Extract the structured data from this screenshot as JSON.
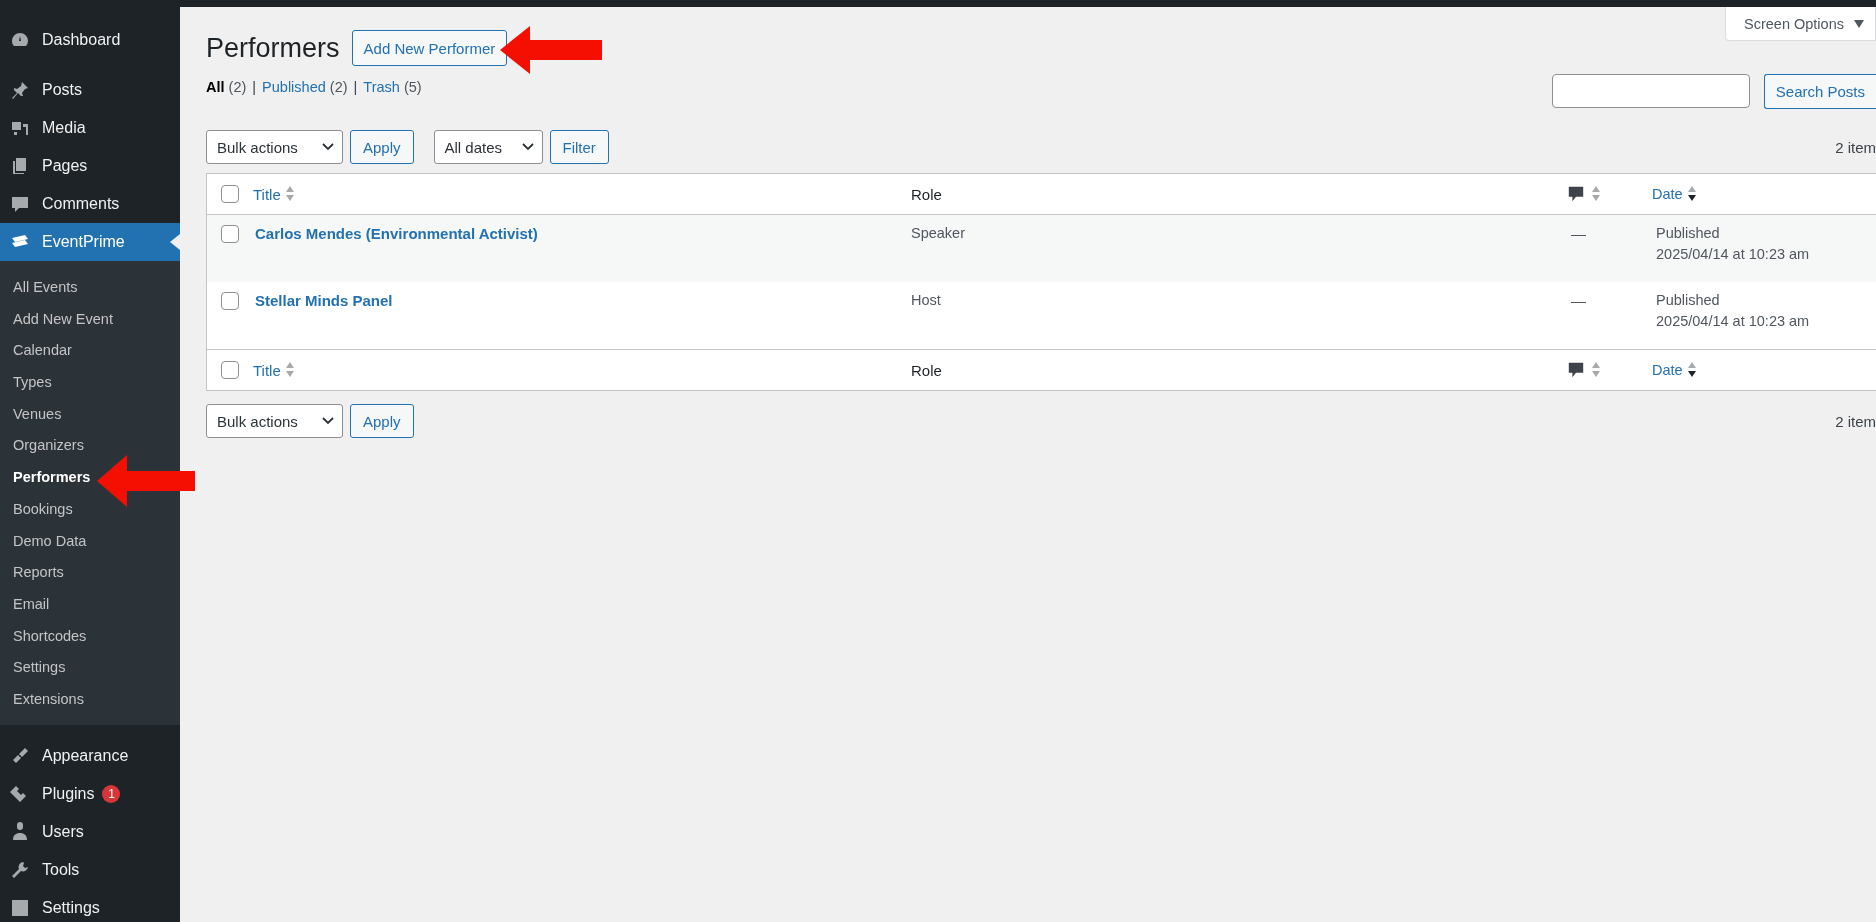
{
  "sidebar": {
    "menu": [
      {
        "label": "Dashboard",
        "selected": false
      },
      {
        "label": "Posts",
        "selected": false
      },
      {
        "label": "Media",
        "selected": false
      },
      {
        "label": "Pages",
        "selected": false
      },
      {
        "label": "Comments",
        "selected": false
      },
      {
        "label": "EventPrime",
        "selected": true,
        "children": [
          {
            "label": "All Events",
            "selected": false
          },
          {
            "label": "Add New Event",
            "selected": false
          },
          {
            "label": "Calendar",
            "selected": false
          },
          {
            "label": "Types",
            "selected": false
          },
          {
            "label": "Venues",
            "selected": false
          },
          {
            "label": "Organizers",
            "selected": false
          },
          {
            "label": "Performers",
            "selected": true
          },
          {
            "label": "Bookings",
            "selected": false
          },
          {
            "label": "Demo Data",
            "selected": false
          },
          {
            "label": "Reports",
            "selected": false
          },
          {
            "label": "Email",
            "selected": false
          },
          {
            "label": "Shortcodes",
            "selected": false
          },
          {
            "label": "Settings",
            "selected": false
          },
          {
            "label": "Extensions",
            "selected": false
          }
        ]
      },
      {
        "label": "Appearance",
        "selected": false
      },
      {
        "label": "Plugins",
        "selected": false,
        "badge": "1"
      },
      {
        "label": "Users",
        "selected": false
      },
      {
        "label": "Tools",
        "selected": false
      },
      {
        "label": "Settings",
        "selected": false
      }
    ]
  },
  "screen_options": {
    "label": "Screen Options"
  },
  "page": {
    "title": "Performers",
    "add_button": "Add New Performer"
  },
  "views": [
    {
      "label": "All",
      "count": "(2)",
      "selected": true
    },
    {
      "separator": "|",
      "label": "Published",
      "count": "(2)",
      "selected": false
    },
    {
      "separator": "|",
      "label": "Trash",
      "count": "(5)",
      "selected": false
    }
  ],
  "search": {
    "button": "Search Posts"
  },
  "top_nav": {
    "bulk_actions": "Bulk actions",
    "apply": "Apply",
    "dates": "All dates",
    "filter": "Filter",
    "items_count": "2 item"
  },
  "table": {
    "header_select_all_checked": false,
    "footer_select_all_checked": false,
    "header_columns": [
      {
        "kind": "title",
        "label": "Title",
        "sorted": false
      },
      {
        "kind": "role",
        "label": "Role"
      },
      {
        "kind": "comments",
        "sorted": false
      },
      {
        "kind": "date",
        "label": "Date",
        "sorted": true
      }
    ],
    "rows": [
      {
        "title": "Carlos Mendes (Environmental Activist)",
        "role": "Speaker",
        "comments": "—",
        "status": "Published",
        "date": "2025/04/14 at 10:23 am",
        "checked": false
      },
      {
        "title": "Stellar Minds Panel",
        "role": "Host",
        "comments": "—",
        "status": "Published",
        "date": "2025/04/14 at 10:23 am",
        "checked": false
      }
    ],
    "footer_columns": [
      {
        "kind": "title",
        "label": "Title",
        "sorted": false
      },
      {
        "kind": "role",
        "label": "Role"
      },
      {
        "kind": "comments",
        "sorted": false
      },
      {
        "kind": "date",
        "label": "Date",
        "sorted": true
      }
    ]
  },
  "bottom_nav": {
    "bulk_actions": "Bulk actions",
    "apply": "Apply",
    "items_count": "2 item"
  }
}
